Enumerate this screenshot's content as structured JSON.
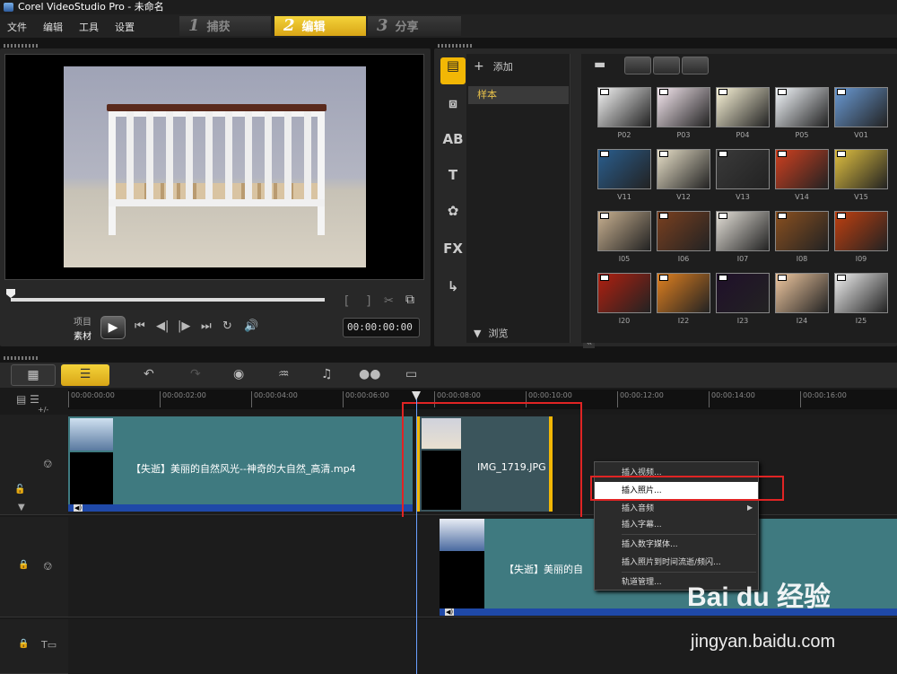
{
  "window": {
    "title": "Corel VideoStudio Pro - 未命名"
  },
  "menu": {
    "items": [
      "文件",
      "编辑",
      "工具",
      "设置"
    ]
  },
  "steps": [
    {
      "num": "1",
      "label": "捕获"
    },
    {
      "num": "2",
      "label": "编辑"
    },
    {
      "num": "3",
      "label": "分享"
    }
  ],
  "player": {
    "mode_project": "项目",
    "mode_clip": "素材",
    "timecode": "00:00:00:00",
    "mark_in": "[",
    "mark_out": "]"
  },
  "library": {
    "add_label": "添加",
    "folder_selected": "样本",
    "browse_label": "浏览",
    "thumbnails": [
      {
        "label": "P02",
        "color": "#f4f4f4"
      },
      {
        "label": "P03",
        "color": "#f6e8f0"
      },
      {
        "label": "P04",
        "color": "#fbf5d8"
      },
      {
        "label": "P05",
        "color": "#f4f8fc"
      },
      {
        "label": "V01",
        "color": "#6a9ad4"
      },
      {
        "label": "V11",
        "color": "#2a5e8e"
      },
      {
        "label": "V12",
        "color": "#e8e0c8"
      },
      {
        "label": "V13",
        "color": "#3a3a3a"
      },
      {
        "label": "V14",
        "color": "#d04020"
      },
      {
        "label": "V15",
        "color": "#e0c040"
      },
      {
        "label": "I05",
        "color": "#c8b090"
      },
      {
        "label": "I06",
        "color": "#7a4020"
      },
      {
        "label": "I07",
        "color": "#e4e0d8"
      },
      {
        "label": "I08",
        "color": "#8a5020"
      },
      {
        "label": "I09",
        "color": "#c04010"
      },
      {
        "label": "I20",
        "color": "#b02010"
      },
      {
        "label": "I22",
        "color": "#e08020"
      },
      {
        "label": "I23",
        "color": "#20102a"
      },
      {
        "label": "I24",
        "color": "#f0c8a0"
      },
      {
        "label": "I25",
        "color": "#f0f0f0"
      }
    ]
  },
  "timeline": {
    "ruler": [
      "00:00:00:00",
      "00:00:02:00",
      "00:00:04:00",
      "00:00:06:00",
      "00:00:08:00",
      "00:00:10:00",
      "00:00:12:00",
      "00:00:14:00",
      "00:00:16:00"
    ],
    "add_track": "+/-",
    "video_clip": "【失逝】美丽的自然风光--神奇的大自然_高清.mp4",
    "photo_clip": "IMG_1719.JPG",
    "overlay_clip": "【失逝】美丽的自"
  },
  "context_menu": {
    "items": [
      "插入视频...",
      "插入照片...",
      "插入音频",
      "插入字幕...",
      "插入数字媒体...",
      "插入照片到时间流逝/频闪...",
      "轨道管理..."
    ],
    "highlighted": "插入照片..."
  },
  "watermark": {
    "brand": "Bai du 经验",
    "url": "jingyan.baidu.com"
  },
  "colors": {
    "accent": "#e8c14a",
    "highlight_box": "#e02424",
    "clip_fill": "#3f7a80"
  }
}
